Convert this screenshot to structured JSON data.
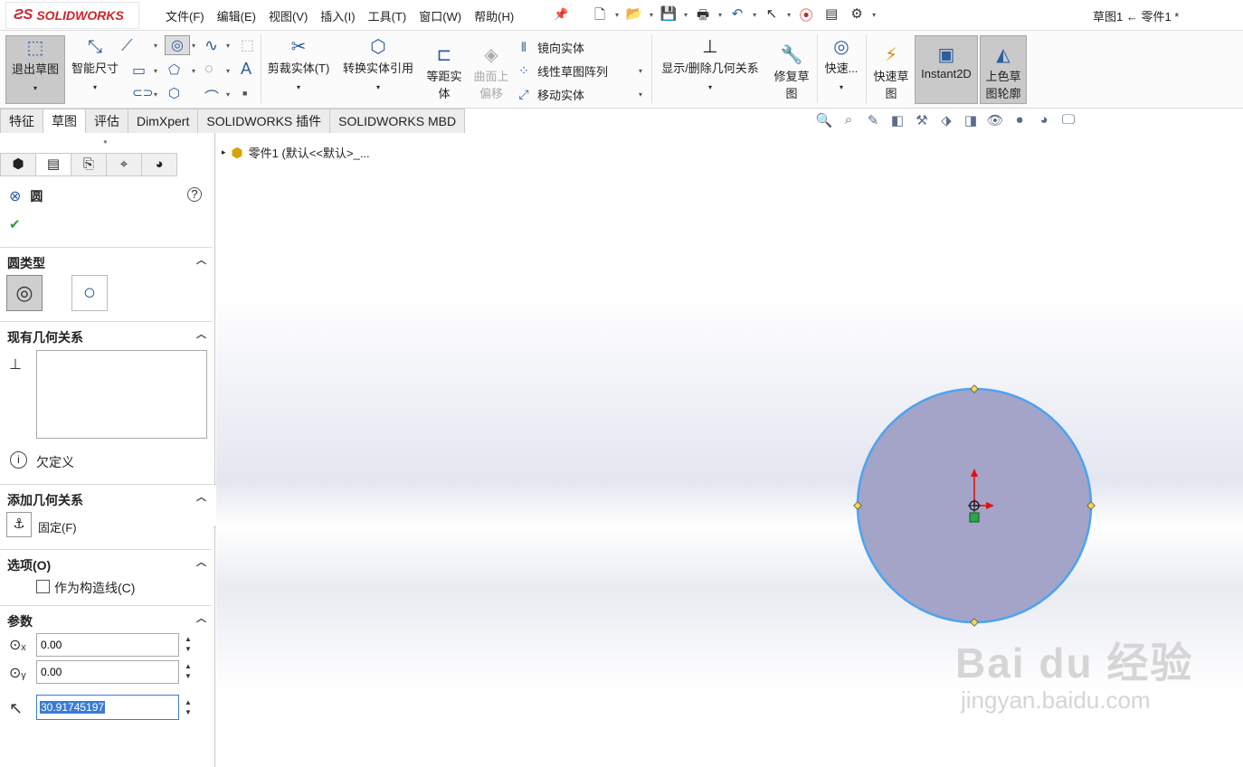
{
  "app": {
    "logo": "SOLIDWORKS",
    "doc_title": "草图1 ← 零件1 *"
  },
  "menu": [
    "文件(F)",
    "编辑(E)",
    "视图(V)",
    "插入(I)",
    "工具(T)",
    "窗口(W)",
    "帮助(H)"
  ],
  "ribbon": {
    "exit_sketch": "退出草图",
    "smart_dim": "智能尺寸",
    "trim": "剪裁实体(T)",
    "convert": "转换实体引用",
    "offset_line1": "等距实",
    "offset_line2": "体",
    "surface_offset_line1": "曲面上",
    "surface_offset_line2": "偏移",
    "mirror": "镜向实体",
    "linear_pattern": "线性草图阵列",
    "move": "移动实体",
    "display_relations": "显示/删除几何关系",
    "repair_line1": "修复草",
    "repair_line2": "图",
    "quick_snap": "快速...",
    "rapid_line1": "快速草",
    "rapid_line2": "图",
    "instant2d": "Instant2D",
    "shaded_line1": "上色草",
    "shaded_line2": "图轮廓"
  },
  "tabs": [
    "特征",
    "草图",
    "评估",
    "DimXpert",
    "SOLIDWORKS 插件",
    "SOLIDWORKS MBD"
  ],
  "active_tab": 1,
  "tree": {
    "part_label": "零件1  (默认<<默认>_..."
  },
  "property_manager": {
    "title": "圆",
    "sections": {
      "circle_type": "圆类型",
      "existing_relations": "现有几何关系",
      "status": "欠定义",
      "add_relations": "添加几何关系",
      "fix": "固定(F)",
      "options": "选项(O)",
      "construction": "作为构造线(C)",
      "parameters": "参数"
    },
    "params": {
      "cx": "0.00",
      "cy": "0.00",
      "radius": "30.91745197"
    }
  },
  "watermark": {
    "line1": "Bai du 经验",
    "line2": "jingyan.baidu.com"
  },
  "colors": {
    "circle_fill": "#a3a4c8",
    "circle_stroke": "#4da3f0",
    "accent": "#2a5e9e"
  }
}
